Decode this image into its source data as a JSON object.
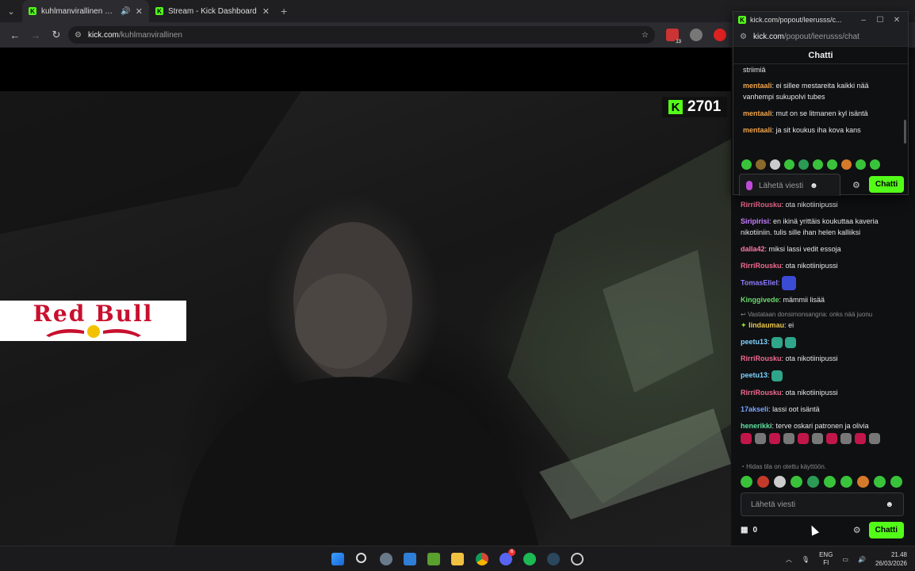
{
  "browser": {
    "tabs": [
      {
        "label": "kuhlmanvirallinen Stream -",
        "active": true,
        "audio": true
      },
      {
        "label": "Stream - Kick Dashboard",
        "active": false
      }
    ],
    "address": {
      "host": "kick.com",
      "path": "/kuhlmanvirallinen"
    },
    "extension_badge": "13"
  },
  "stream": {
    "viewer_count": "2701",
    "sponsor_logo": "Red Bull"
  },
  "popout": {
    "window_title": "kick.com/popout/leerusss/c...",
    "url_host": "kick.com",
    "url_path": "/popout/leerusss/chat",
    "header": "Chatti",
    "messages": [
      {
        "user": "",
        "text": "striimiä"
      },
      {
        "user": "mentaali",
        "text": "ei sillee mestareita kaikki nää vanhempi sukupolvi tubes"
      },
      {
        "user": "mentaali",
        "text": "mut on se litmanen kyl isäntä"
      },
      {
        "user": "mentaali",
        "text": "ja sit koukus iha kova kans"
      }
    ],
    "input_placeholder": "Lähetä viesti",
    "send_label": "Chatti"
  },
  "chat": {
    "messages": [
      {
        "user": "RirriRousku",
        "color": "#f06a8f",
        "text": "ota nikotiinipussi"
      },
      {
        "user": "Siripirisi",
        "color": "#c77dff",
        "text": "en ikinä yrittäis koukuttaa kaveria nikotiiniin. tulis sille ihan helen kalliiksi"
      },
      {
        "user": "dalla42",
        "color": "#ff7aa8",
        "text": "miksi lassi vedit essoja"
      },
      {
        "user": "RirriRousku",
        "color": "#f06a8f",
        "text": "ota nikotiinipussi"
      },
      {
        "user": "TomasEliel",
        "color": "#8c7cff",
        "text": ""
      },
      {
        "user": "Kinggivede",
        "color": "#6ad96a",
        "text": "mämmii lisää"
      },
      {
        "user": "lindaumau",
        "color": "#e8c84a",
        "text": "ei"
      },
      {
        "user": "peetu13",
        "color": "#7fd3ff",
        "text": ""
      },
      {
        "user": "RirriRousku",
        "color": "#f06a8f",
        "text": "ota nikotiinipussi"
      },
      {
        "user": "peetu13",
        "color": "#7fd3ff",
        "text": ""
      },
      {
        "user": "RirriRousku",
        "color": "#f06a8f",
        "text": "ota nikotiinipussi"
      },
      {
        "user": "17akseli",
        "color": "#7aa7ff",
        "text": "lassi oot isäntä"
      },
      {
        "user": "henerikki",
        "color": "#5fe0a0",
        "text": "terve oskari patronen ja olivia"
      }
    ],
    "reply_context": "Vastataan donsimonsangria: onks nää juonu",
    "slow_mode": "Hidas tila on otettu käyttöön.",
    "input_placeholder": "Lähetä viesti",
    "points": "0",
    "send_label": "Chatti"
  },
  "taskbar": {
    "language": "ENG",
    "region": "FI",
    "time": "21.48",
    "date": "26/03/2026",
    "discord_badge": "6"
  }
}
